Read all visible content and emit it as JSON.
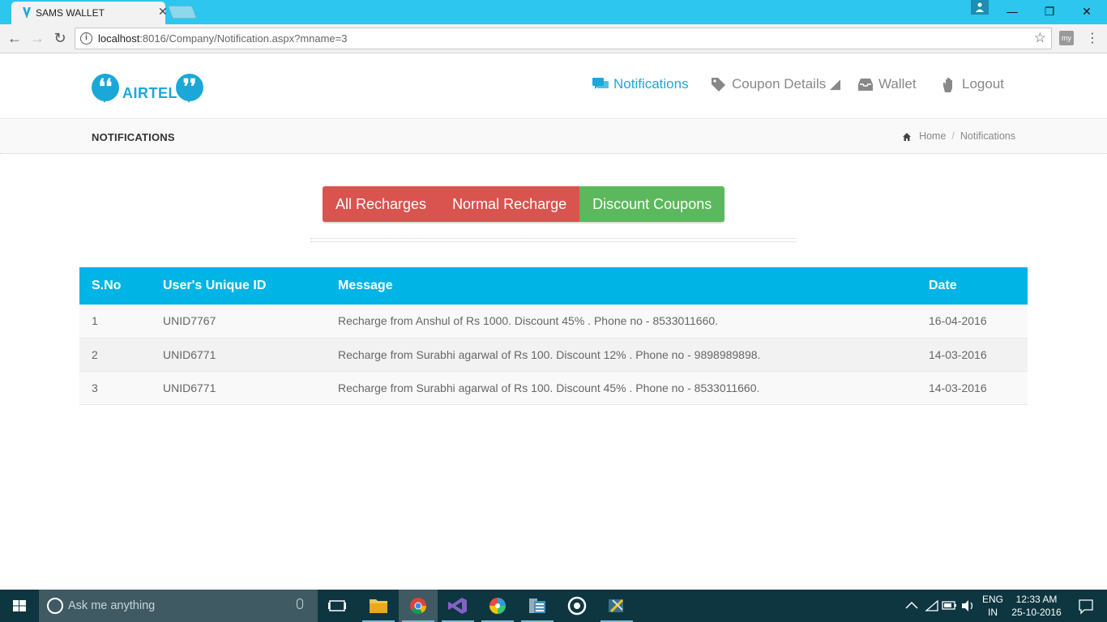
{
  "browser": {
    "tab_title": "SAMS WALLET",
    "url_host": "localhost",
    "url_rest": ":8016/Company/Notification.aspx?mname=3",
    "ext_label": "my"
  },
  "site": {
    "logo_text": "AIRTEL",
    "nav": [
      {
        "label": "Notifications"
      },
      {
        "label": "Coupon Details ◢"
      },
      {
        "label": "Wallet"
      },
      {
        "label": "Logout"
      }
    ],
    "page_title": "NOTIFICATIONS",
    "breadcrumb": {
      "home": "Home",
      "sep": "/",
      "current": "Notifications"
    }
  },
  "filters": [
    {
      "label": "All Recharges",
      "color": "#d9534f"
    },
    {
      "label": "Normal Recharge",
      "color": "#d9534f"
    },
    {
      "label": "Discount Coupons",
      "color": "#5cb85c"
    }
  ],
  "table": {
    "headers": [
      "S.No",
      "User's Unique ID",
      "Message",
      "Date"
    ],
    "rows": [
      [
        "1",
        "UNID7767",
        "Recharge from Anshul of Rs 1000. Discount 45% . Phone no - 8533011660.",
        "16-04-2016"
      ],
      [
        "2",
        "UNID6771",
        "Recharge from Surabhi agarwal of Rs 100. Discount 12% . Phone no - 9898989898.",
        "14-03-2016"
      ],
      [
        "3",
        "UNID6771",
        "Recharge from Surabhi agarwal of Rs 100. Discount 45% . Phone no - 8533011660.",
        "14-03-2016"
      ]
    ]
  },
  "taskbar": {
    "search_placeholder": "Ask me anything",
    "lang_top": "ENG",
    "lang_bottom": "IN",
    "time": "12:33 AM",
    "date": "25-10-2016"
  },
  "colors": {
    "brand": "#1ba8d8",
    "table_header": "#00b4e6",
    "tab_strip": "#2dc6ee"
  }
}
